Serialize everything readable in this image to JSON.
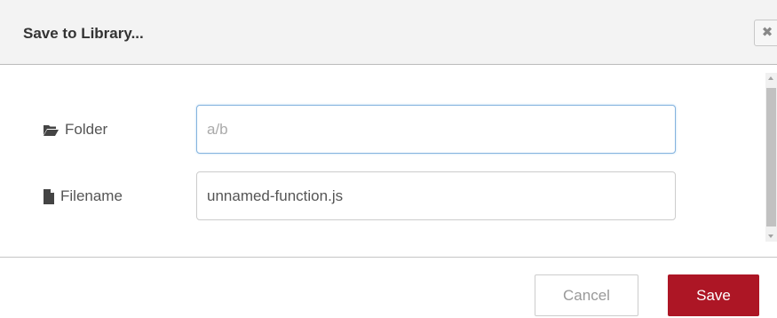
{
  "dialog": {
    "title": "Save to Library...",
    "close_icon": "close-icon"
  },
  "form": {
    "folder": {
      "icon": "folder-open-icon",
      "label": "Folder",
      "value": "",
      "placeholder": "a/b"
    },
    "filename": {
      "icon": "file-icon",
      "label": "Filename",
      "value": "unnamed-function.js"
    }
  },
  "footer": {
    "cancel_label": "Cancel",
    "save_label": "Save"
  },
  "colors": {
    "primary": "#ad1625",
    "focus_border": "#85b3de"
  }
}
